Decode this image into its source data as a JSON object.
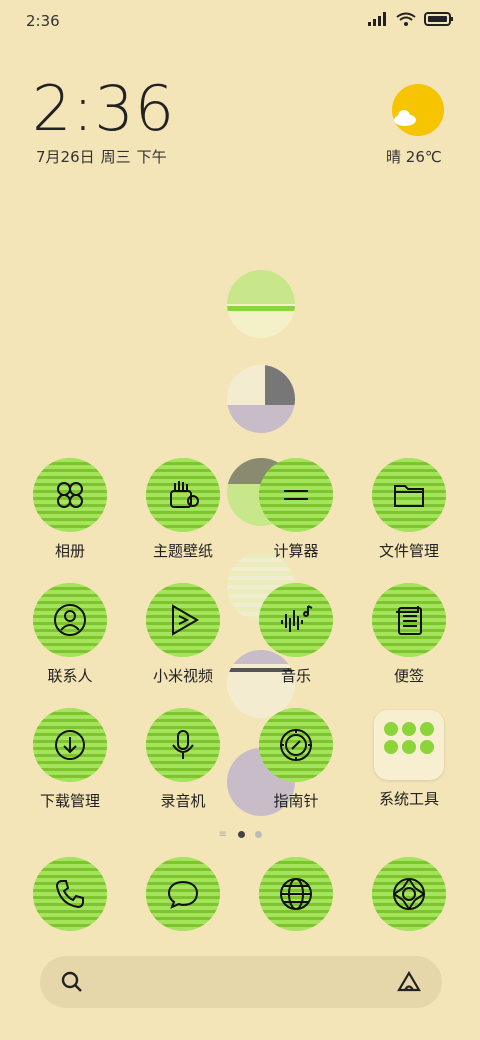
{
  "status_bar": {
    "time": "2:36"
  },
  "clock": {
    "time": "2:36",
    "date": "7月26日",
    "weekday": "周三",
    "period": "下午"
  },
  "weather": {
    "condition": "晴",
    "temperature": "26℃",
    "icon": "sun-cloud-icon"
  },
  "apps": [
    {
      "label": "相册",
      "icon": "gallery-icon"
    },
    {
      "label": "主题壁纸",
      "icon": "theme-icon"
    },
    {
      "label": "计算器",
      "icon": "calculator-icon"
    },
    {
      "label": "文件管理",
      "icon": "folder-icon"
    },
    {
      "label": "联系人",
      "icon": "contacts-icon"
    },
    {
      "label": "小米视频",
      "icon": "video-icon"
    },
    {
      "label": "音乐",
      "icon": "music-icon"
    },
    {
      "label": "便签",
      "icon": "notes-icon"
    },
    {
      "label": "下载管理",
      "icon": "download-icon"
    },
    {
      "label": "录音机",
      "icon": "recorder-icon"
    },
    {
      "label": "指南针",
      "icon": "compass-icon"
    },
    {
      "label": "系统工具",
      "icon": "tools-folder-icon"
    }
  ],
  "dock": [
    {
      "icon": "phone-icon"
    },
    {
      "icon": "messages-icon"
    },
    {
      "icon": "browser-icon"
    },
    {
      "icon": "camera-icon"
    }
  ],
  "colors": {
    "background": "#f3e5b8",
    "accent": "#8bd53a",
    "sun": "#f6c400"
  }
}
